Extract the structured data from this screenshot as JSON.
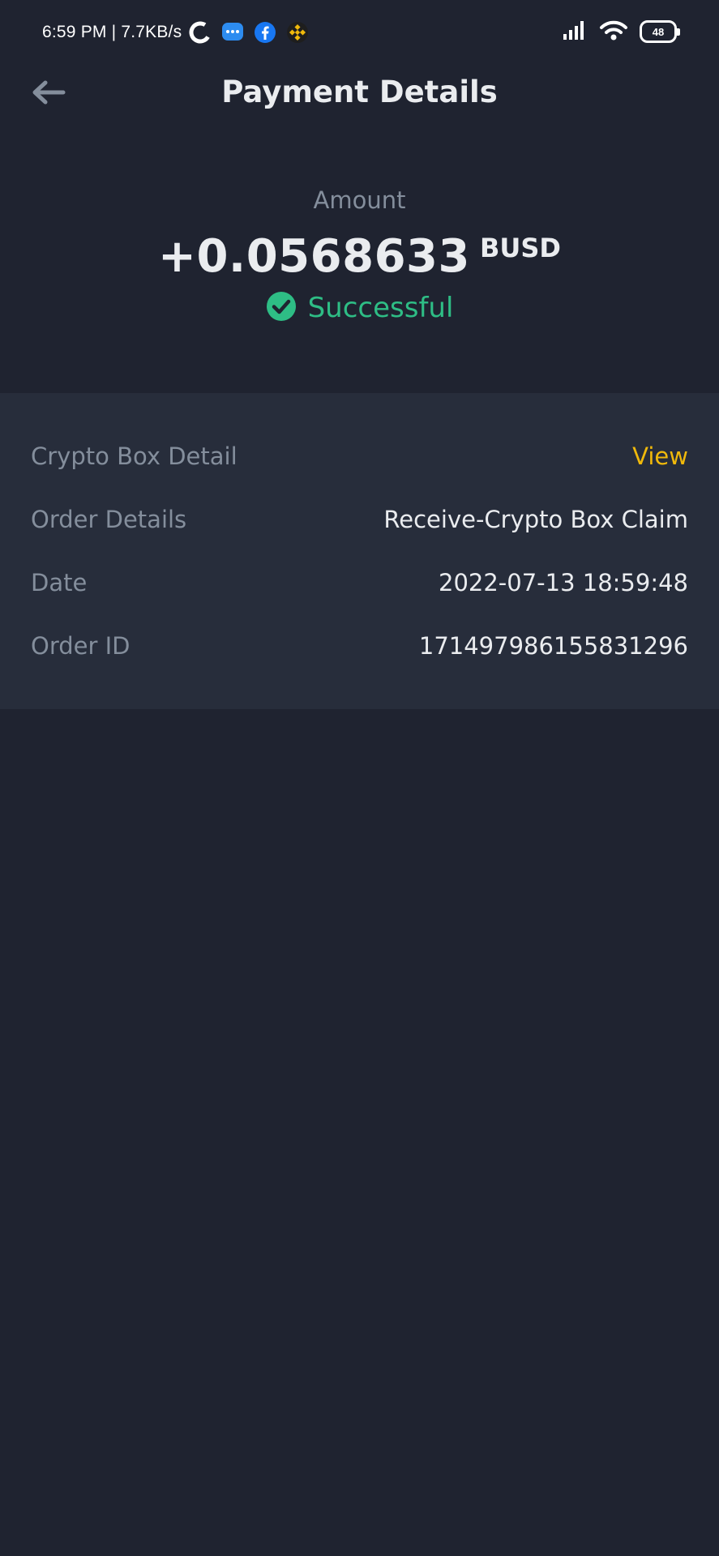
{
  "status_bar": {
    "time_speed": "6:59 PM | 7.7KB/s",
    "app_icons": [
      "c-app-icon",
      "messages-icon",
      "facebook-icon",
      "binance-icon"
    ],
    "battery_level": "48"
  },
  "header": {
    "back_icon": "arrow-left-icon",
    "title": "Payment Details"
  },
  "amount": {
    "label": "Amount",
    "value": "+0.0568633",
    "unit": "BUSD",
    "status": "Successful",
    "status_color": "#2ebd85"
  },
  "details": {
    "rows": [
      {
        "label": "Crypto Box Detail",
        "value": "View"
      },
      {
        "label": "Order Details",
        "value": "Receive-Crypto Box Claim"
      },
      {
        "label": "Date",
        "value": "2022-07-13 18:59:48"
      },
      {
        "label": "Order ID",
        "value": "171497986155831296"
      }
    ]
  },
  "colors": {
    "background": "#1f2330",
    "card": "#272d3b",
    "accent": "#f0b90b",
    "success": "#2ebd85",
    "muted": "#848e9c"
  }
}
